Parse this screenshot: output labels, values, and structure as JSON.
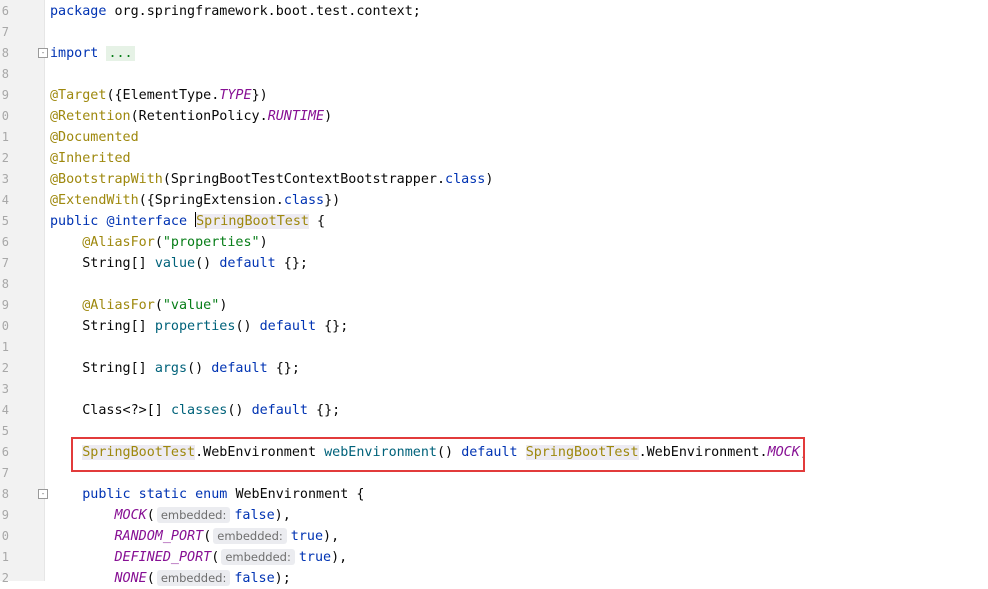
{
  "lines": [
    {
      "num": "6",
      "tokens": [
        [
          "kw",
          "package "
        ],
        [
          "",
          "org.springframework.boot.test.context;"
        ]
      ]
    },
    {
      "num": "7",
      "tokens": []
    },
    {
      "num": "8",
      "tokens": [
        [
          "kw",
          "import "
        ],
        [
          "importdots",
          "..."
        ]
      ]
    },
    {
      "num": "8",
      "tokens": []
    },
    {
      "num": "9",
      "tokens": [
        [
          "ann",
          "@Target"
        ],
        [
          "",
          "({ElementType."
        ],
        [
          "const",
          "TYPE"
        ],
        [
          "",
          "})"
        ]
      ]
    },
    {
      "num": "0",
      "tokens": [
        [
          "ann",
          "@Retention"
        ],
        [
          "",
          "(RetentionPolicy."
        ],
        [
          "const",
          "RUNTIME"
        ],
        [
          "",
          ")"
        ]
      ]
    },
    {
      "num": "1",
      "tokens": [
        [
          "ann",
          "@Documented"
        ]
      ]
    },
    {
      "num": "2",
      "tokens": [
        [
          "ann",
          "@Inherited"
        ]
      ]
    },
    {
      "num": "3",
      "tokens": [
        [
          "ann",
          "@BootstrapWith"
        ],
        [
          "",
          "(SpringBootTestContextBootstrapper."
        ],
        [
          "kw",
          "class"
        ],
        [
          "",
          ")"
        ]
      ]
    },
    {
      "num": "4",
      "tokens": [
        [
          "ann",
          "@ExtendWith"
        ],
        [
          "",
          "({SpringExtension."
        ],
        [
          "kw",
          "class"
        ],
        [
          "",
          "})"
        ]
      ]
    },
    {
      "num": "5",
      "tokens": [
        [
          "kw",
          "public "
        ],
        [
          "kw",
          "@interface "
        ],
        [
          "caret",
          ""
        ],
        [
          "hl",
          "SpringBootTest"
        ],
        [
          "",
          " {"
        ]
      ]
    },
    {
      "num": "6",
      "tokens": [
        [
          "",
          "    "
        ],
        [
          "ann",
          "@AliasFor"
        ],
        [
          "",
          "("
        ],
        [
          "str",
          "\"properties\""
        ],
        [
          "",
          ")"
        ]
      ]
    },
    {
      "num": "7",
      "tokens": [
        [
          "",
          "    String[] "
        ],
        [
          "fn",
          "value"
        ],
        [
          "",
          "() "
        ],
        [
          "kw",
          "default"
        ],
        [
          "",
          " {};"
        ]
      ]
    },
    {
      "num": "8",
      "tokens": []
    },
    {
      "num": "9",
      "tokens": [
        [
          "",
          "    "
        ],
        [
          "ann",
          "@AliasFor"
        ],
        [
          "",
          "("
        ],
        [
          "str",
          "\"value\""
        ],
        [
          "",
          ")"
        ]
      ]
    },
    {
      "num": "0",
      "tokens": [
        [
          "",
          "    String[] "
        ],
        [
          "fn",
          "properties"
        ],
        [
          "",
          "() "
        ],
        [
          "kw",
          "default"
        ],
        [
          "",
          " {};"
        ]
      ]
    },
    {
      "num": "1",
      "tokens": []
    },
    {
      "num": "2",
      "tokens": [
        [
          "",
          "    String[] "
        ],
        [
          "fn",
          "args"
        ],
        [
          "",
          "() "
        ],
        [
          "kw",
          "default"
        ],
        [
          "",
          " {};"
        ]
      ]
    },
    {
      "num": "3",
      "tokens": []
    },
    {
      "num": "4",
      "tokens": [
        [
          "",
          "    Class<?>[] "
        ],
        [
          "fn",
          "classes"
        ],
        [
          "",
          "() "
        ],
        [
          "kw",
          "default"
        ],
        [
          "",
          " {};"
        ]
      ]
    },
    {
      "num": "5",
      "tokens": []
    },
    {
      "num": "6",
      "tokens": [
        [
          "",
          "    "
        ],
        [
          "hl",
          "SpringBootTest"
        ],
        [
          "",
          ".WebEnvironment "
        ],
        [
          "fn",
          "webEnvironment"
        ],
        [
          "",
          "() "
        ],
        [
          "kw",
          "default "
        ],
        [
          "hl",
          "SpringBootTest"
        ],
        [
          "",
          ".WebEnvironment."
        ],
        [
          "const",
          "MOCK"
        ],
        [
          "",
          ";"
        ]
      ]
    },
    {
      "num": "7",
      "tokens": []
    },
    {
      "num": "8",
      "tokens": [
        [
          "",
          "    "
        ],
        [
          "kw",
          "public static enum "
        ],
        [
          "",
          "WebEnvironment {"
        ]
      ]
    },
    {
      "num": "9",
      "tokens": [
        [
          "",
          "        "
        ],
        [
          "const",
          "MOCK"
        ],
        [
          "",
          "("
        ],
        [
          "hint",
          "embedded:"
        ],
        [
          "kw",
          "false"
        ],
        [
          "",
          "),"
        ]
      ]
    },
    {
      "num": "0",
      "tokens": [
        [
          "",
          "        "
        ],
        [
          "const",
          "RANDOM_PORT"
        ],
        [
          "",
          "("
        ],
        [
          "hint",
          "embedded:"
        ],
        [
          "kw",
          "true"
        ],
        [
          "",
          "),"
        ]
      ]
    },
    {
      "num": "1",
      "tokens": [
        [
          "",
          "        "
        ],
        [
          "const",
          "DEFINED_PORT"
        ],
        [
          "",
          "("
        ],
        [
          "hint",
          "embedded:"
        ],
        [
          "kw",
          "true"
        ],
        [
          "",
          "),"
        ]
      ]
    },
    {
      "num": "2",
      "tokens": [
        [
          "",
          "        "
        ],
        [
          "const",
          "NONE"
        ],
        [
          "",
          "("
        ],
        [
          "hint",
          "embedded:"
        ],
        [
          "kw",
          "false"
        ],
        [
          "",
          ");"
        ]
      ]
    }
  ]
}
